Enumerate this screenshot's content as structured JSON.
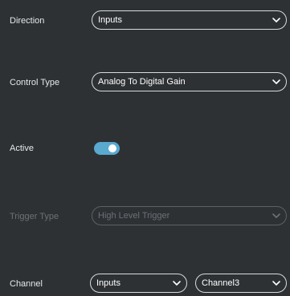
{
  "direction": {
    "label": "Direction",
    "value": "Inputs"
  },
  "control_type": {
    "label": "Control Type",
    "value": "Analog To Digital Gain"
  },
  "active": {
    "label": "Active",
    "on": true
  },
  "trigger_type": {
    "label": "Trigger Type",
    "value": "High Level Trigger",
    "disabled": true
  },
  "channel": {
    "label": "Channel",
    "direction_value": "Inputs",
    "channel_value": "Channel3"
  },
  "colors": {
    "background": "#2e3134",
    "toggle_on": "#5aa9cf",
    "border": "#d9dcdf",
    "disabled_text": "#6c7176"
  }
}
